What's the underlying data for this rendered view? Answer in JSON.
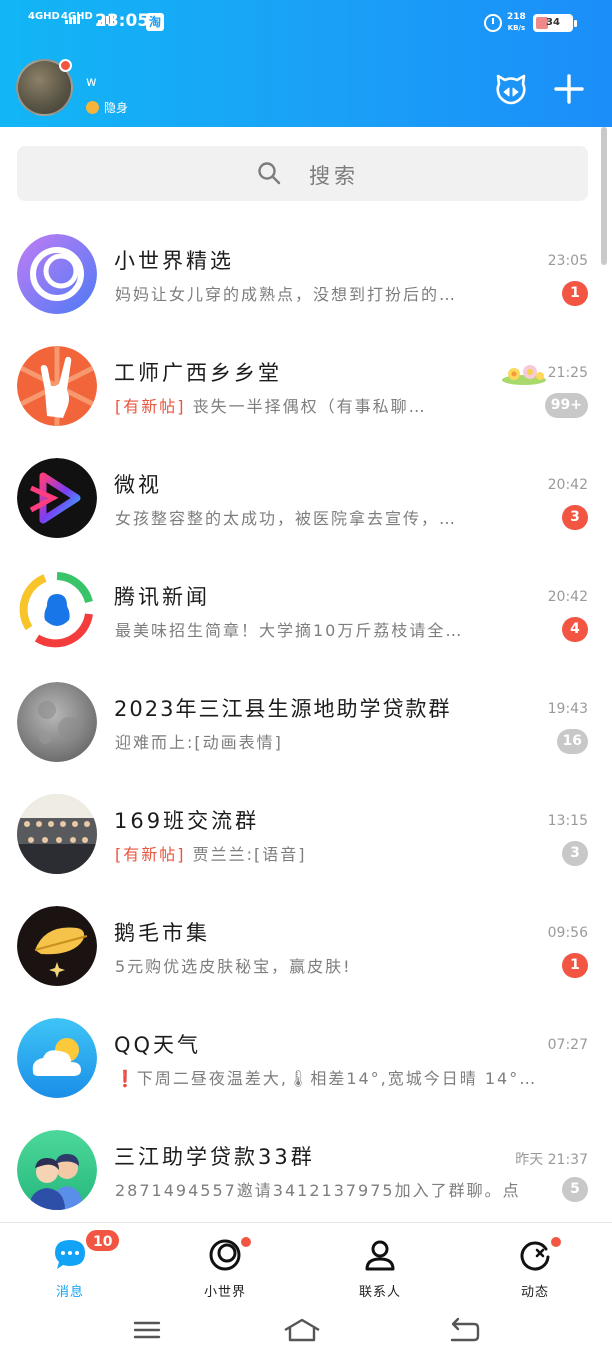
{
  "status_bar": {
    "sim1": "4GHD",
    "sim2": "4GHD",
    "time": "23:05",
    "taobao_icon": "淘",
    "net_speed_value": "218",
    "net_speed_unit": "KB/s",
    "battery_level": "34"
  },
  "header": {
    "nickname": "w",
    "status": "隐身"
  },
  "search": {
    "placeholder": "搜索"
  },
  "conversations": [
    {
      "title": "小世界精选",
      "preview": "妈妈让女儿穿的成熟点，没想到打扮后的…",
      "tag": "",
      "time": "23:05",
      "badge": "1",
      "badge_color": "red"
    },
    {
      "title": "工师广西乡乡堂",
      "preview": "丧失一半择偶权（有事私聊…",
      "tag": "[有新帖]",
      "time": "21:25",
      "badge": "99+",
      "badge_color": "grey"
    },
    {
      "title": "微视",
      "preview": "女孩整容整的太成功，被医院拿去宣传，…",
      "tag": "",
      "time": "20:42",
      "badge": "3",
      "badge_color": "red"
    },
    {
      "title": "腾讯新闻",
      "preview": "最美味招生简章！大学摘10万斤荔枝请全…",
      "tag": "",
      "time": "20:42",
      "badge": "4",
      "badge_color": "red"
    },
    {
      "title": "2023年三江县生源地助学贷款群",
      "preview": "迎难而上:[动画表情]",
      "tag": "",
      "time": "19:43",
      "badge": "16",
      "badge_color": "grey"
    },
    {
      "title": "169班交流群",
      "preview": "贾兰兰:[语音]",
      "tag": "[有新帖]",
      "time": "13:15",
      "badge": "3",
      "badge_color": "grey"
    },
    {
      "title": "鹅毛市集",
      "preview": "5元购优选皮肤秘宝，赢皮肤!",
      "tag": "",
      "time": "09:56",
      "badge": "1",
      "badge_color": "red"
    },
    {
      "title": "QQ天气",
      "preview": "❗下周二昼夜温差大,🌡相差14°,宽城今日晴 14°…",
      "tag": "",
      "time": "07:27",
      "badge": "",
      "badge_color": ""
    },
    {
      "title": "三江助学贷款33群",
      "preview": "2871494557邀请3412137975加入了群聊。点…",
      "tag": "",
      "time": "昨天 21:37",
      "badge": "5",
      "badge_color": "grey"
    }
  ],
  "tabs": [
    {
      "label": "消息",
      "badge": "10"
    },
    {
      "label": "小世界"
    },
    {
      "label": "联系人"
    },
    {
      "label": "动态"
    }
  ],
  "colors": {
    "accent": "#12a3f7",
    "badge_red": "#f25643",
    "badge_grey": "#c8c8c8"
  }
}
